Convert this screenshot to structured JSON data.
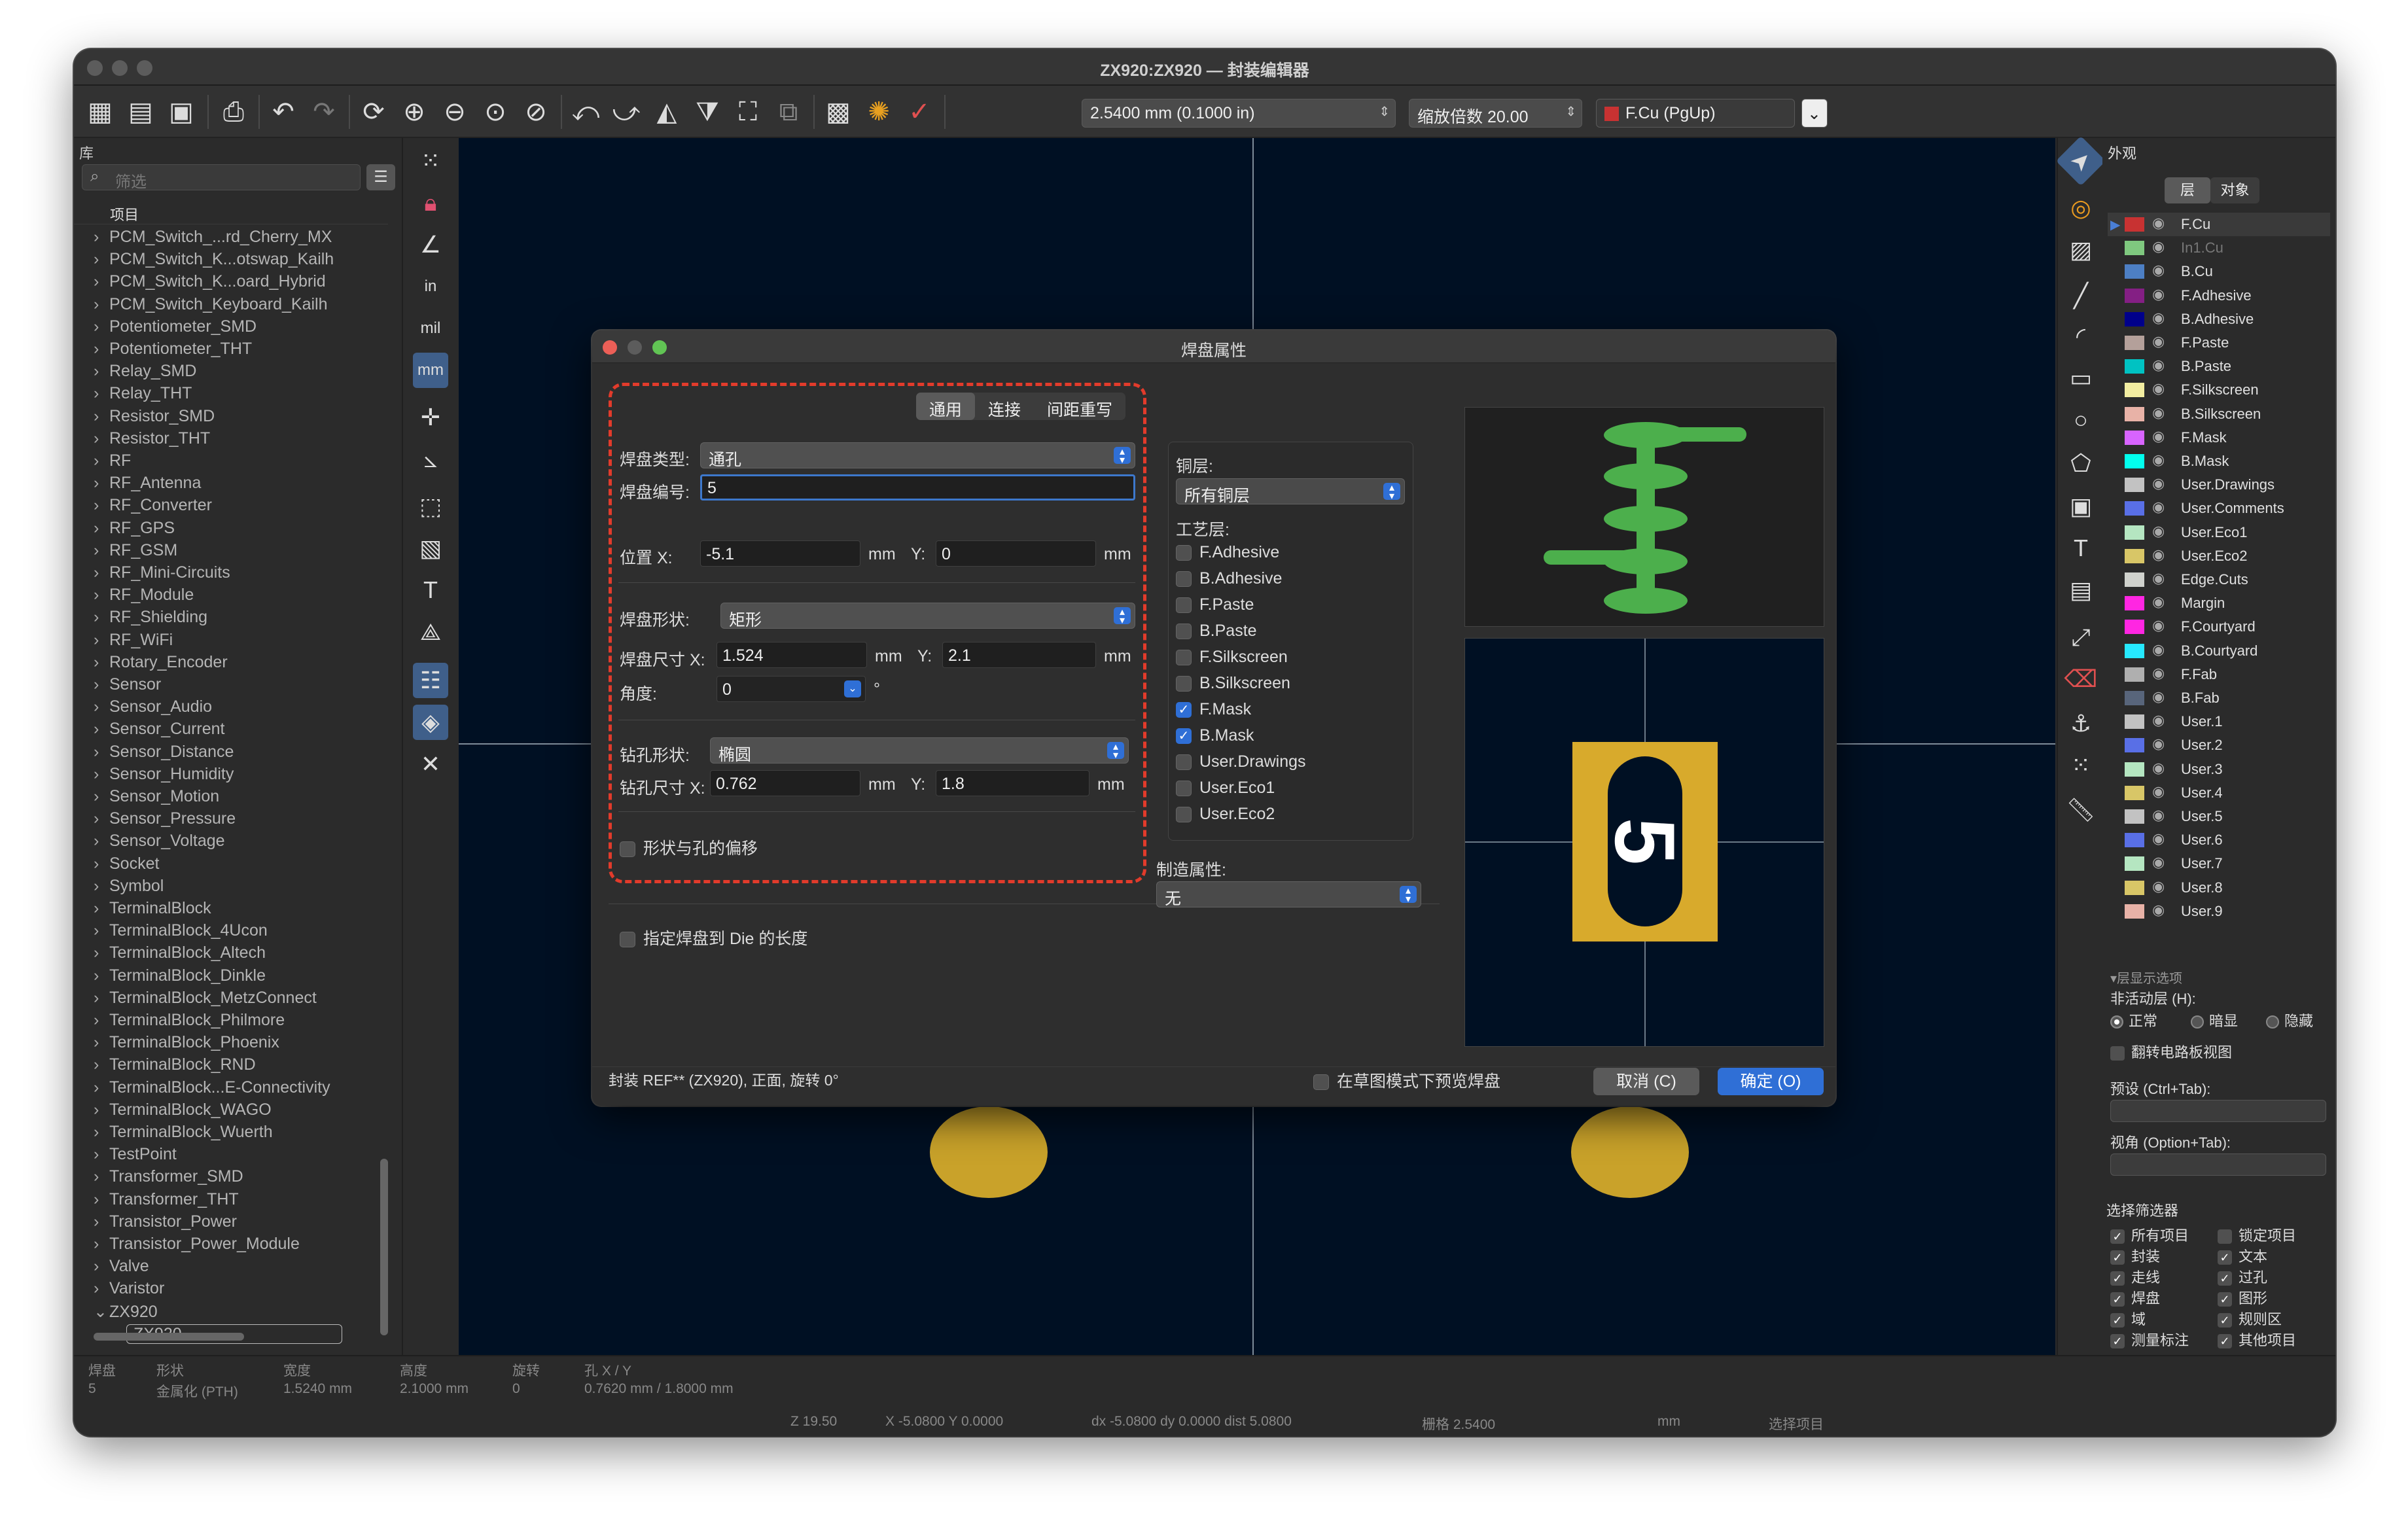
{
  "window": {
    "title": "ZX920:ZX920 — 封装编辑器"
  },
  "toolbar": {
    "grid": "2.5400 mm (0.1000 in)",
    "zoom": "缩放倍数 20.00",
    "layer": "F.Cu (PgUp)",
    "layer_color": "#c83232",
    "icons": [
      "new-footprint-icon",
      "import-footprint-icon",
      "save-icon",
      "print-icon",
      "undo-icon",
      "redo-icon",
      "refresh-icon",
      "zoom-in-icon",
      "zoom-out-icon",
      "zoom-fit-icon",
      "zoom-selection-icon",
      "rotate-ccw-icon",
      "rotate-cw-icon",
      "mirror-h-icon",
      "mirror-v-icon",
      "group-icon",
      "ungroup-icon",
      "pad-table-icon",
      "footprint-checker-icon",
      "drc-icon"
    ]
  },
  "library": {
    "header": "库",
    "filter_placeholder": "筛选",
    "column": "项目",
    "items": [
      "PCM_Switch_...rd_Cherry_MX",
      "PCM_Switch_K...otswap_Kailh",
      "PCM_Switch_K...oard_Hybrid",
      "PCM_Switch_Keyboard_Kailh",
      "Potentiometer_SMD",
      "Potentiometer_THT",
      "Relay_SMD",
      "Relay_THT",
      "Resistor_SMD",
      "Resistor_THT",
      "RF",
      "RF_Antenna",
      "RF_Converter",
      "RF_GPS",
      "RF_GSM",
      "RF_Mini-Circuits",
      "RF_Module",
      "RF_Shielding",
      "RF_WiFi",
      "Rotary_Encoder",
      "Sensor",
      "Sensor_Audio",
      "Sensor_Current",
      "Sensor_Distance",
      "Sensor_Humidity",
      "Sensor_Motion",
      "Sensor_Pressure",
      "Sensor_Voltage",
      "Socket",
      "Symbol",
      "TerminalBlock",
      "TerminalBlock_4Ucon",
      "TerminalBlock_Altech",
      "TerminalBlock_Dinkle",
      "TerminalBlock_MetzConnect",
      "TerminalBlock_Philmore",
      "TerminalBlock_Phoenix",
      "TerminalBlock_RND",
      "TerminalBlock...E-Connectivity",
      "TerminalBlock_WAGO",
      "TerminalBlock_Wuerth",
      "TestPoint",
      "Transformer_SMD",
      "Transformer_THT",
      "Transistor_Power",
      "Transistor_Power_Module",
      "Valve",
      "Varistor",
      "ZX920"
    ],
    "child": "ZX920"
  },
  "left_tools": [
    "grid-icon",
    "lock-icon",
    "polar-icon",
    "inch-unit-icon",
    "mil-unit-icon",
    "mm-unit-icon",
    "cursor-cross-icon",
    "measure-angle-icon",
    "pad-outline-icon",
    "via-outline-icon",
    "text-outline-icon",
    "graphic-outline-icon",
    "footprint-tree-icon",
    "layers-icon",
    "properties-icon"
  ],
  "left_tool_text": {
    "in": "in",
    "mil": "mil",
    "mm": "mm"
  },
  "right_tools": [
    "select-arrow-icon",
    "add-pad-icon",
    "add-zone-icon",
    "add-line-icon",
    "add-arc-icon",
    "add-rect-icon",
    "add-circle-icon",
    "add-polygon-icon",
    "add-image-icon",
    "add-text-icon",
    "add-textbox-icon",
    "add-dimension-icon",
    "delete-icon",
    "set-anchor-icon",
    "grid-origin-icon",
    "measure-icon"
  ],
  "appearance": {
    "title": "外观",
    "tab_layers": "层",
    "tab_objects": "对象",
    "layers": [
      {
        "name": "F.Cu",
        "color": "#c83232",
        "active": true
      },
      {
        "name": "In1.Cu",
        "color": "#7fc87f",
        "dim": true
      },
      {
        "name": "B.Cu",
        "color": "#4d7fc4"
      },
      {
        "name": "F.Adhesive",
        "color": "#841f84"
      },
      {
        "name": "B.Adhesive",
        "color": "#00008b"
      },
      {
        "name": "F.Paste",
        "color": "#b4a09a"
      },
      {
        "name": "B.Paste",
        "color": "#00c2c2"
      },
      {
        "name": "F.Silkscreen",
        "color": "#f2eda1"
      },
      {
        "name": "B.Silkscreen",
        "color": "#e8b2a7"
      },
      {
        "name": "F.Mask",
        "color": "#d864ff"
      },
      {
        "name": "B.Mask",
        "color": "#02ffee"
      },
      {
        "name": "User.Drawings",
        "color": "#c2c2c2"
      },
      {
        "name": "User.Comments",
        "color": "#596fe6"
      },
      {
        "name": "User.Eco1",
        "color": "#b5e6c1"
      },
      {
        "name": "User.Eco2",
        "color": "#d8c667"
      },
      {
        "name": "Edge.Cuts",
        "color": "#d0d2cd"
      },
      {
        "name": "Margin",
        "color": "#ff26e2"
      },
      {
        "name": "F.Courtyard",
        "color": "#ff26e2"
      },
      {
        "name": "B.Courtyard",
        "color": "#26e9ff"
      },
      {
        "name": "F.Fab",
        "color": "#afafaf"
      },
      {
        "name": "B.Fab",
        "color": "#58657b"
      },
      {
        "name": "User.1",
        "color": "#c2c2c2"
      },
      {
        "name": "User.2",
        "color": "#596fe6"
      },
      {
        "name": "User.3",
        "color": "#b5e6c1"
      },
      {
        "name": "User.4",
        "color": "#d8c667"
      },
      {
        "name": "User.5",
        "color": "#c2c2c2"
      },
      {
        "name": "User.6",
        "color": "#596fe6"
      },
      {
        "name": "User.7",
        "color": "#b5e6c1"
      },
      {
        "name": "User.8",
        "color": "#d8c667"
      },
      {
        "name": "User.9",
        "color": "#e8b2a7"
      }
    ],
    "display_options": "▾层显示选项",
    "inactive_layers": "非活动层 (H):",
    "radio_normal": "正常",
    "radio_dim": "暗显",
    "radio_hide": "隐藏",
    "flip_board": "翻转电路板视图",
    "preset": "预设 (Ctrl+Tab):",
    "viewport": "视角 (Option+Tab):",
    "selection_filter": "选择筛选器",
    "filters_left": [
      "所有项目",
      "封装",
      "走线",
      "焊盘",
      "域",
      "测量标注"
    ],
    "filters_right": [
      "锁定项目",
      "文本",
      "过孔",
      "图形",
      "规则区",
      "其他项目"
    ]
  },
  "status": {
    "headers": [
      "焊盘",
      "形状",
      "宽度",
      "高度",
      "旋转",
      "孔 X / Y"
    ],
    "values": [
      "5",
      "金属化 (PTH)",
      "1.5240 mm",
      "2.1000 mm",
      "0",
      "0.7620 mm / 1.8000 mm"
    ],
    "zoom": "Z 19.50",
    "xy": "X -5.0800  Y 0.0000",
    "dxy": "dx -5.0800  dy 0.0000  dist 5.0800",
    "grid": "栅格 2.5400",
    "unit": "mm",
    "mode": "选择项目"
  },
  "dialog": {
    "title": "焊盘属性",
    "tabs": [
      "通用",
      "连接",
      "间距重写"
    ],
    "pad_type_label": "焊盘类型:",
    "pad_type": "通孔",
    "pad_number_label": "焊盘编号:",
    "pad_number": "5",
    "pos_x_label": "位置 X:",
    "pos_x": "-5.1",
    "pos_y_label": "Y:",
    "pos_y": "0",
    "unit": "mm",
    "shape_label": "焊盘形状:",
    "shape": "矩形",
    "size_x_label": "焊盘尺寸 X:",
    "size_x": "1.524",
    "size_y": "2.1",
    "angle_label": "角度:",
    "angle": "0",
    "degree": "°",
    "drill_shape_label": "钻孔形状:",
    "drill_shape": "椭圆",
    "drill_x_label": "钻孔尺寸 X:",
    "drill_x": "0.762",
    "drill_y": "1.8",
    "offset": "形状与孔的偏移",
    "die_length": "指定焊盘到 Die 的长度",
    "copper_label": "铜层:",
    "copper": "所有铜层",
    "tech_label": "工艺层:",
    "tech_layers": [
      {
        "name": "F.Adhesive",
        "checked": false
      },
      {
        "name": "B.Adhesive",
        "checked": false
      },
      {
        "name": "F.Paste",
        "checked": false
      },
      {
        "name": "B.Paste",
        "checked": false
      },
      {
        "name": "F.Silkscreen",
        "checked": false
      },
      {
        "name": "B.Silkscreen",
        "checked": false
      },
      {
        "name": "F.Mask",
        "checked": true
      },
      {
        "name": "B.Mask",
        "checked": true
      },
      {
        "name": "User.Drawings",
        "checked": false
      },
      {
        "name": "User.Eco1",
        "checked": false
      },
      {
        "name": "User.Eco2",
        "checked": false
      }
    ],
    "fab_label": "制造属性:",
    "fab": "无",
    "preview_number": "5",
    "footer_info": "封装 REF** (ZX920), 正面, 旋转 0°",
    "sketch_preview": "在草图模式下预览焊盘",
    "cancel": "取消 (C)",
    "ok": "确定 (O)"
  }
}
